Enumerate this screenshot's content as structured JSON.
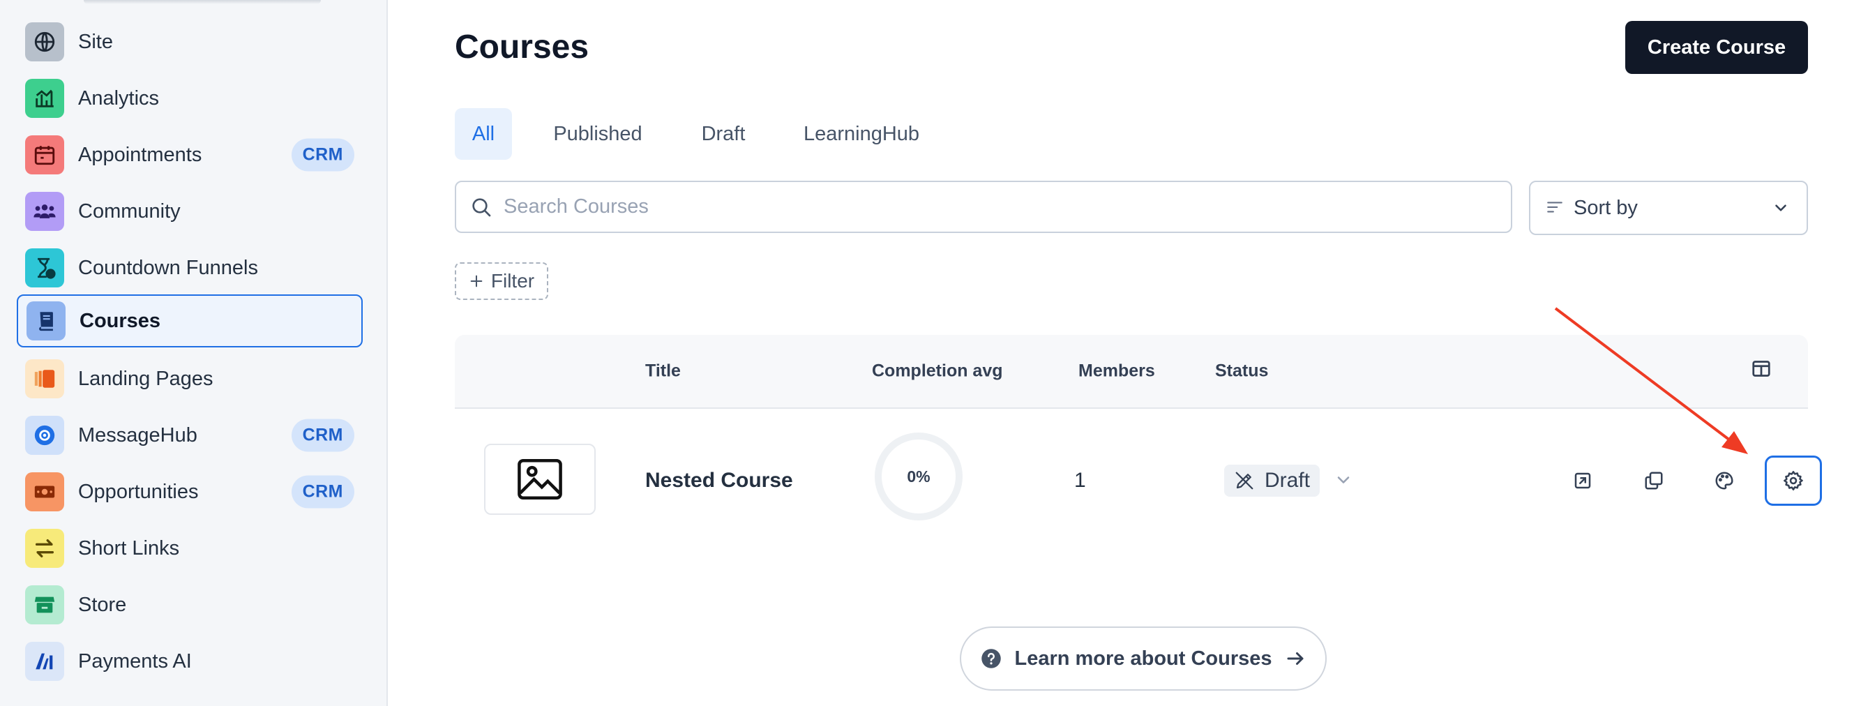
{
  "sidebar": {
    "items": [
      {
        "label": "Site",
        "icon": "globe-icon",
        "color": "#b7c0cb",
        "badge": ""
      },
      {
        "label": "Analytics",
        "icon": "bar-chart-icon",
        "color": "#3dcf8e",
        "badge": ""
      },
      {
        "label": "Appointments",
        "icon": "calendar-icon",
        "color": "#f47a7a",
        "badge": "CRM"
      },
      {
        "label": "Community",
        "icon": "people-icon",
        "color": "#b29cf6",
        "badge": ""
      },
      {
        "label": "Countdown Funnels",
        "icon": "hourglass-icon",
        "color": "#2dc6d6",
        "badge": ""
      },
      {
        "label": "Courses",
        "icon": "book-icon",
        "color": "#8fb3ef",
        "badge": "",
        "active": true
      },
      {
        "label": "Landing Pages",
        "icon": "pages-icon",
        "color": "#fde7c7",
        "badge": ""
      },
      {
        "label": "MessageHub",
        "icon": "chat-gear-icon",
        "color": "#cfe0fa",
        "badge": "CRM"
      },
      {
        "label": "Opportunities",
        "icon": "money-icon",
        "color": "#f79564",
        "badge": "CRM"
      },
      {
        "label": "Short Links",
        "icon": "swap-arrows-icon",
        "color": "#f7ea7a",
        "badge": ""
      },
      {
        "label": "Store",
        "icon": "store-icon",
        "color": "#b4ebd1",
        "badge": ""
      },
      {
        "label": "Payments AI",
        "icon": "ai-logo-icon",
        "color": "#dbe6f8",
        "badge": ""
      }
    ]
  },
  "header": {
    "title": "Courses",
    "create_label": "Create Course"
  },
  "tabs": [
    {
      "label": "All",
      "active": true
    },
    {
      "label": "Published",
      "active": false
    },
    {
      "label": "Draft",
      "active": false
    },
    {
      "label": "LearningHub",
      "active": false
    }
  ],
  "search": {
    "placeholder": "Search Courses",
    "value": ""
  },
  "sort": {
    "label": "Sort by"
  },
  "filter": {
    "label": "Filter"
  },
  "table": {
    "columns": {
      "title": "Title",
      "completion": "Completion avg",
      "members": "Members",
      "status": "Status"
    },
    "rows": [
      {
        "title": "Nested Course",
        "completion": "0%",
        "completion_fraction": 0,
        "members": "1",
        "status": "Draft"
      }
    ]
  },
  "learn_more": {
    "label": "Learn more about Courses"
  },
  "colors": {
    "accent": "#1f6fe5",
    "primary_button": "#111827",
    "annotation_arrow": "#ee3b24"
  }
}
